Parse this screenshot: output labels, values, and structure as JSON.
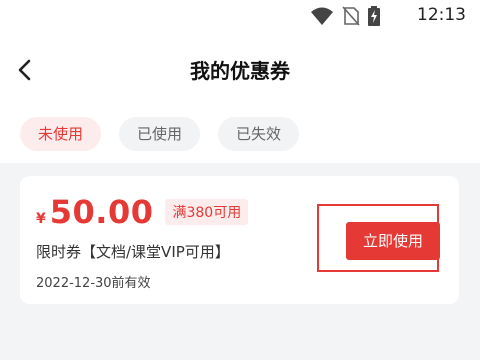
{
  "status_bar": {
    "time": "12:13",
    "icons": [
      "wifi-icon",
      "no-sim-icon",
      "battery-charging-icon"
    ]
  },
  "header": {
    "title": "我的优惠券",
    "back_icon": "chevron-left-icon"
  },
  "tabs": [
    {
      "label": "未使用",
      "active": true
    },
    {
      "label": "已使用",
      "active": false
    },
    {
      "label": "已失效",
      "active": false
    }
  ],
  "coupon": {
    "currency": "¥",
    "amount": "50.00",
    "condition": "满380可用",
    "name": "限时券【文档/课堂VIP可用】",
    "expiry": "2022-12-30前有效",
    "action_label": "立即使用"
  },
  "colors": {
    "accent": "#e53935",
    "accent_light": "#fdecec",
    "background": "#f3f4f6"
  }
}
